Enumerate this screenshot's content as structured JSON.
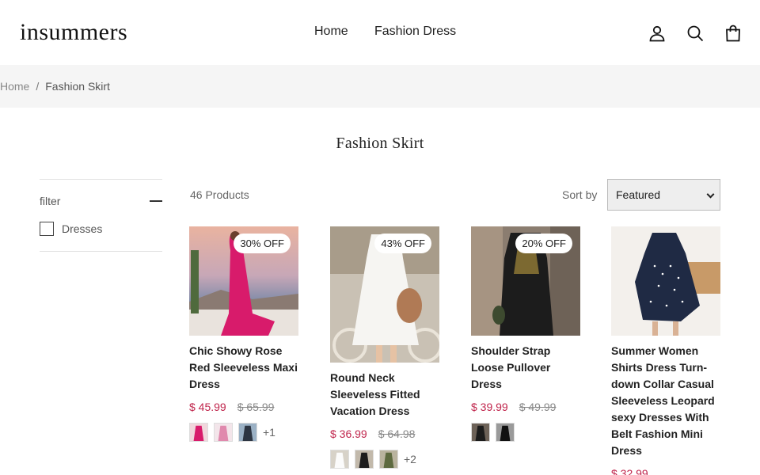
{
  "header": {
    "logo": "insummers",
    "nav": [
      "Home",
      "Fashion Dress"
    ]
  },
  "icons": {
    "account": "user-icon",
    "search": "search-icon",
    "cart": "cart-bag-icon"
  },
  "breadcrumb": {
    "home": "Home",
    "separator": "/",
    "current": "Fashion Skirt"
  },
  "page": {
    "title": "Fashion Skirt"
  },
  "filter": {
    "title": "filter",
    "options": [
      {
        "label": "Dresses",
        "checked": false
      }
    ]
  },
  "toolbar": {
    "count": "46 Products",
    "sort_label": "Sort by",
    "sort_value": "Featured"
  },
  "products": [
    {
      "badge": "30% OFF",
      "title": "Chic Showy Rose Red Sleeveless Maxi Dress",
      "price": "$ 45.99",
      "old_price": "$ 65.99",
      "more": "+1"
    },
    {
      "badge": "43% OFF",
      "title": "Round Neck Sleeveless Fitted Vacation Dress",
      "price": "$ 36.99",
      "old_price": "$ 64.98",
      "more": "+2"
    },
    {
      "badge": "20% OFF",
      "title": "Shoulder Strap Loose Pullover Dress",
      "price": "$ 39.99",
      "old_price": "$ 49.99",
      "more": ""
    },
    {
      "badge": "",
      "title": "Summer Women Shirts Dress Turn-down Collar Casual Sleeveless Leopard sexy Dresses With Belt Fashion Mini Dress",
      "price": "$ 32.99",
      "old_price": "",
      "more": ""
    }
  ],
  "colors": {
    "sale_price": "#c0254c",
    "breadcrumb_bg": "#f5f5f5"
  }
}
